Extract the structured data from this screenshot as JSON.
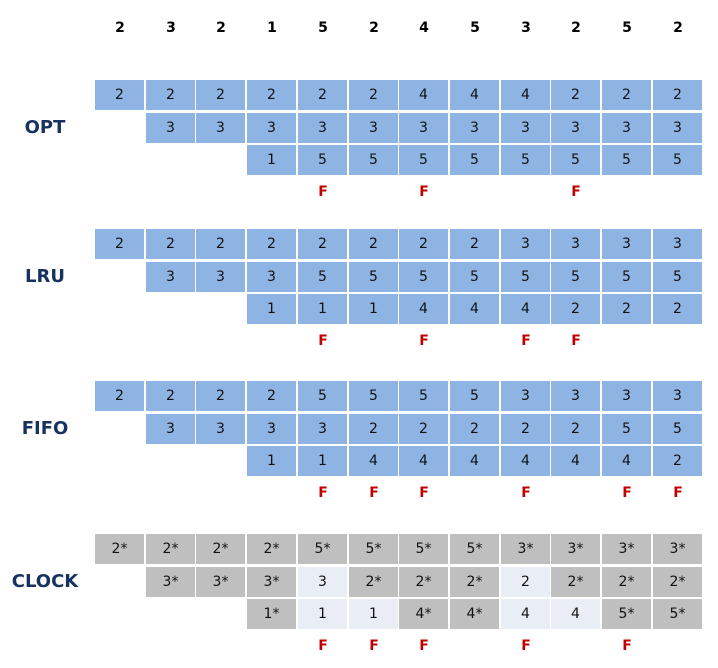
{
  "reference_string": [
    "2",
    "3",
    "2",
    "1",
    "5",
    "2",
    "4",
    "5",
    "3",
    "2",
    "5",
    "2"
  ],
  "colors": {
    "frame": "#8EB4E3",
    "clock_set": "#BFBFBF",
    "clock_clear": "#E9EEF6",
    "fault": "#C00000",
    "label": "#17325E"
  },
  "fault_label": "F",
  "algorithms": [
    {
      "name": "OPT",
      "style": "frame",
      "frames": [
        [
          "2",
          "2",
          "2",
          "2",
          "2",
          "2",
          "4",
          "4",
          "4",
          "2",
          "2",
          "2"
        ],
        [
          null,
          "3",
          "3",
          "3",
          "3",
          "3",
          "3",
          "3",
          "3",
          "3",
          "3",
          "3"
        ],
        [
          null,
          null,
          null,
          "1",
          "5",
          "5",
          "5",
          "5",
          "5",
          "5",
          "5",
          "5"
        ]
      ],
      "faults": [
        false,
        false,
        false,
        false,
        true,
        false,
        true,
        false,
        false,
        true,
        false,
        false
      ]
    },
    {
      "name": "LRU",
      "style": "frame",
      "frames": [
        [
          "2",
          "2",
          "2",
          "2",
          "2",
          "2",
          "2",
          "2",
          "3",
          "3",
          "3",
          "3"
        ],
        [
          null,
          "3",
          "3",
          "3",
          "5",
          "5",
          "5",
          "5",
          "5",
          "5",
          "5",
          "5"
        ],
        [
          null,
          null,
          null,
          "1",
          "1",
          "1",
          "4",
          "4",
          "4",
          "2",
          "2",
          "2"
        ]
      ],
      "faults": [
        false,
        false,
        false,
        false,
        true,
        false,
        true,
        false,
        true,
        true,
        false,
        false
      ]
    },
    {
      "name": "FIFO",
      "style": "frame",
      "frames": [
        [
          "2",
          "2",
          "2",
          "2",
          "5",
          "5",
          "5",
          "5",
          "3",
          "3",
          "3",
          "3"
        ],
        [
          null,
          "3",
          "3",
          "3",
          "3",
          "2",
          "2",
          "2",
          "2",
          "2",
          "5",
          "5"
        ],
        [
          null,
          null,
          null,
          "1",
          "1",
          "4",
          "4",
          "4",
          "4",
          "4",
          "4",
          "2"
        ]
      ],
      "faults": [
        false,
        false,
        false,
        false,
        true,
        true,
        true,
        false,
        true,
        false,
        true,
        true
      ]
    },
    {
      "name": "CLOCK",
      "style": "clock",
      "frames": [
        [
          "2*",
          "2*",
          "2*",
          "2*",
          "5*",
          "5*",
          "5*",
          "5*",
          "3*",
          "3*",
          "3*",
          "3*"
        ],
        [
          null,
          "3*",
          "3*",
          "3*",
          "3",
          "2*",
          "2*",
          "2*",
          "2",
          "2*",
          "2*",
          "2*"
        ],
        [
          null,
          null,
          null,
          "1*",
          "1",
          "1",
          "4*",
          "4*",
          "4",
          "4",
          "5*",
          "5*"
        ]
      ],
      "faults": [
        false,
        false,
        false,
        false,
        true,
        true,
        true,
        false,
        true,
        false,
        true,
        false
      ]
    }
  ]
}
